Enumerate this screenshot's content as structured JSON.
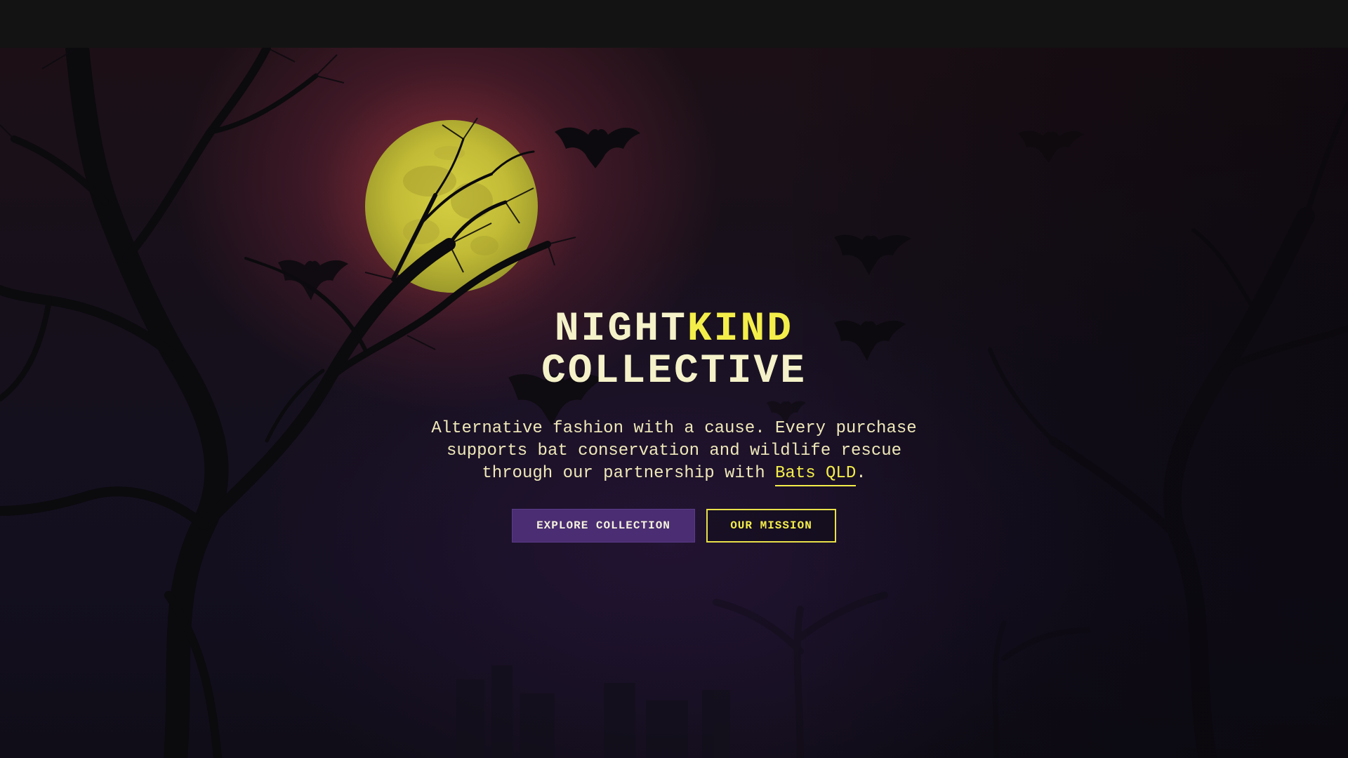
{
  "hero": {
    "title_part1": "NIGHT",
    "title_part2": "KIND",
    "title_line2": "COLLECTIVE",
    "tagline_text": "Alternative fashion with a cause. Every purchase supports bat conservation and wildlife rescue through our partnership with ",
    "tagline_link": "Bats QLD",
    "tagline_end": ".",
    "primary_button": "EXPLORE COLLECTION",
    "secondary_button": "OUR MISSION"
  },
  "colors": {
    "accent_yellow": "#f4ee4a",
    "cream_text": "#f5f2c9",
    "primary_purple": "#4a2d72",
    "topbar": "#131313",
    "moon": "#c9c23a"
  },
  "icons": {
    "moon": "full-moon",
    "bats": "bat-silhouette",
    "trees": "bare-tree-silhouette"
  }
}
